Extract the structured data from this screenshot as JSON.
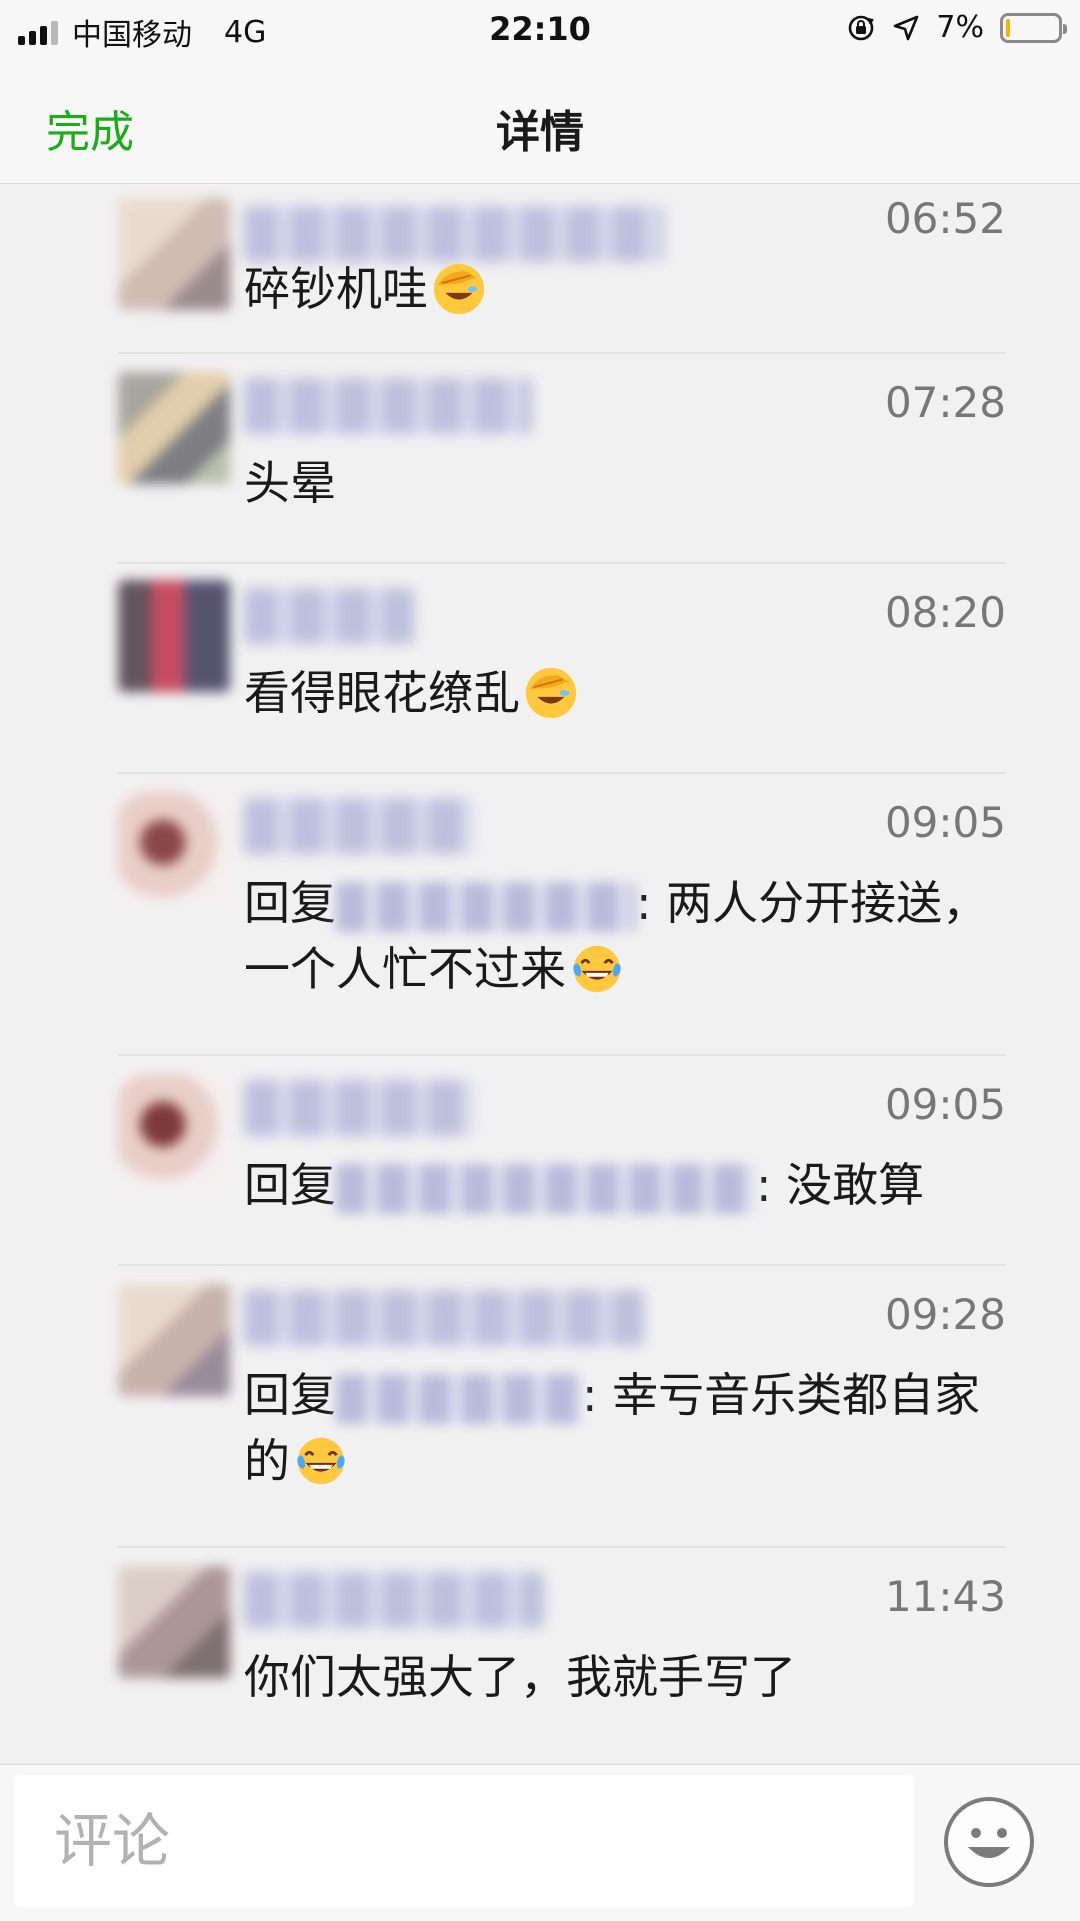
{
  "status_bar": {
    "carrier": "中国移动",
    "network": "4G",
    "time": "22:10",
    "battery_percent": "7%",
    "battery_level": 0.07,
    "icons": [
      "signal-icon",
      "rotation-lock-icon",
      "location-arrow-icon",
      "battery-icon"
    ]
  },
  "nav": {
    "done_label": "完成",
    "title": "详情"
  },
  "comments": [
    {
      "time": "06:52",
      "text_before": "碎钞机哇",
      "emoji": "facepalm-emoji"
    },
    {
      "time": "07:28",
      "text_before": "头晕"
    },
    {
      "time": "08:20",
      "text_before": "看得眼花缭乱",
      "emoji": "facepalm-emoji"
    },
    {
      "time": "09:05",
      "reply_prefix": "回复",
      "text_before": ": 两人分开接送，一个人忙不过来",
      "emoji": "tears-of-joy-emoji"
    },
    {
      "time": "09:05",
      "reply_prefix": "回复",
      "text_before": ": 没敢算"
    },
    {
      "time": "09:28",
      "reply_prefix": "回复",
      "text_before": ": 幸亏音乐类都自家的",
      "emoji": "tears-of-joy-emoji"
    },
    {
      "time": "11:43",
      "text_before": "你们太强大了，我就手写了"
    }
  ],
  "bottom_bar": {
    "placeholder": "评论",
    "emoji_button_icon": "smiley-icon"
  },
  "colors": {
    "accent": "#1aad19",
    "background": "#f2f1f2",
    "bar_background": "#f7f7f7",
    "time_text": "#777777",
    "battery_low": "#f4b400"
  }
}
